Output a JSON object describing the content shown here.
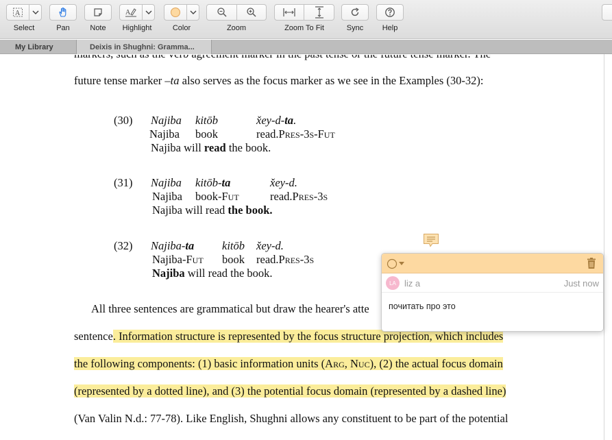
{
  "toolbar": {
    "select": "Select",
    "pan": "Pan",
    "note": "Note",
    "highlight": "Highlight",
    "color": "Color",
    "zoom": "Zoom",
    "zoom_to_fit": "Zoom To Fit",
    "sync": "Sync",
    "help": "Help",
    "highlight_color": "#fdd9a1"
  },
  "tabs": {
    "library": "My Library",
    "document": "Deixis in Shughni: Gramma..."
  },
  "document": {
    "line0": "markers, such as the verb agreement marker in the past tense or the future tense marker. The",
    "line1_a": "future tense marker –",
    "line1_b": "ta",
    "line1_c": " also serves as the focus marker as we see in the Examples (30-32):",
    "ex30": {
      "num": "(30)",
      "w1": "Najiba",
      "w2": "kitōb",
      "w3a": "x̌ey-d-",
      "w3b": "ta",
      "w3c": ".",
      "g1": "Najiba",
      "g2": "book",
      "g3a": "read.",
      "g3b": "Pres-3s-Fut",
      "t1": "Najiba will ",
      "t2": "read",
      "t3": " the book."
    },
    "ex31": {
      "num": "(31)",
      "w1": "Najiba",
      "w2a": "kitōb-",
      "w2b": "ta",
      "w3": "x̌ey-d.",
      "g1": "Najiba",
      "g2a": "book-",
      "g2b": "Fut",
      "g3a": "read.",
      "g3b": "Pres-3s",
      "t1": "Najiba will read ",
      "t2": "the book."
    },
    "ex32": {
      "num": "(32)",
      "w1a": "Najiba-",
      "w1b": "ta",
      "w2": "kitōb",
      "w3": "x̌ey-d.",
      "g1a": "Najiba-",
      "g1b": "Fut",
      "g2": "book",
      "g3a": "read.",
      "g3b": "Pres-3s",
      "t1": "Najiba",
      "t2": " will read the book."
    },
    "para1": "All three sentences are grammatical but draw the hearer's atte",
    "line_s_a": "sentence",
    "line_s_b": ". Information structure is represented by the focus structure projection, which includes",
    "line_h2_a": "the following components: (1) basic information units (",
    "line_h2_b": "Arg",
    "line_h2_c": ", ",
    "line_h2_d": "Nuc",
    "line_h2_e": "), (2) the actual focus domain",
    "line_h3": "(represented by a dotted line), and (3) the potential focus domain (represented by a dashed line)",
    "line_last": "(Van Valin N.d.: 77-78). Like English, Shughni allows any constituent to be part of the potential"
  },
  "annotation": {
    "avatar_initials": "LA",
    "user": "liz a",
    "time": "Just now",
    "comment": "почитать про это"
  }
}
